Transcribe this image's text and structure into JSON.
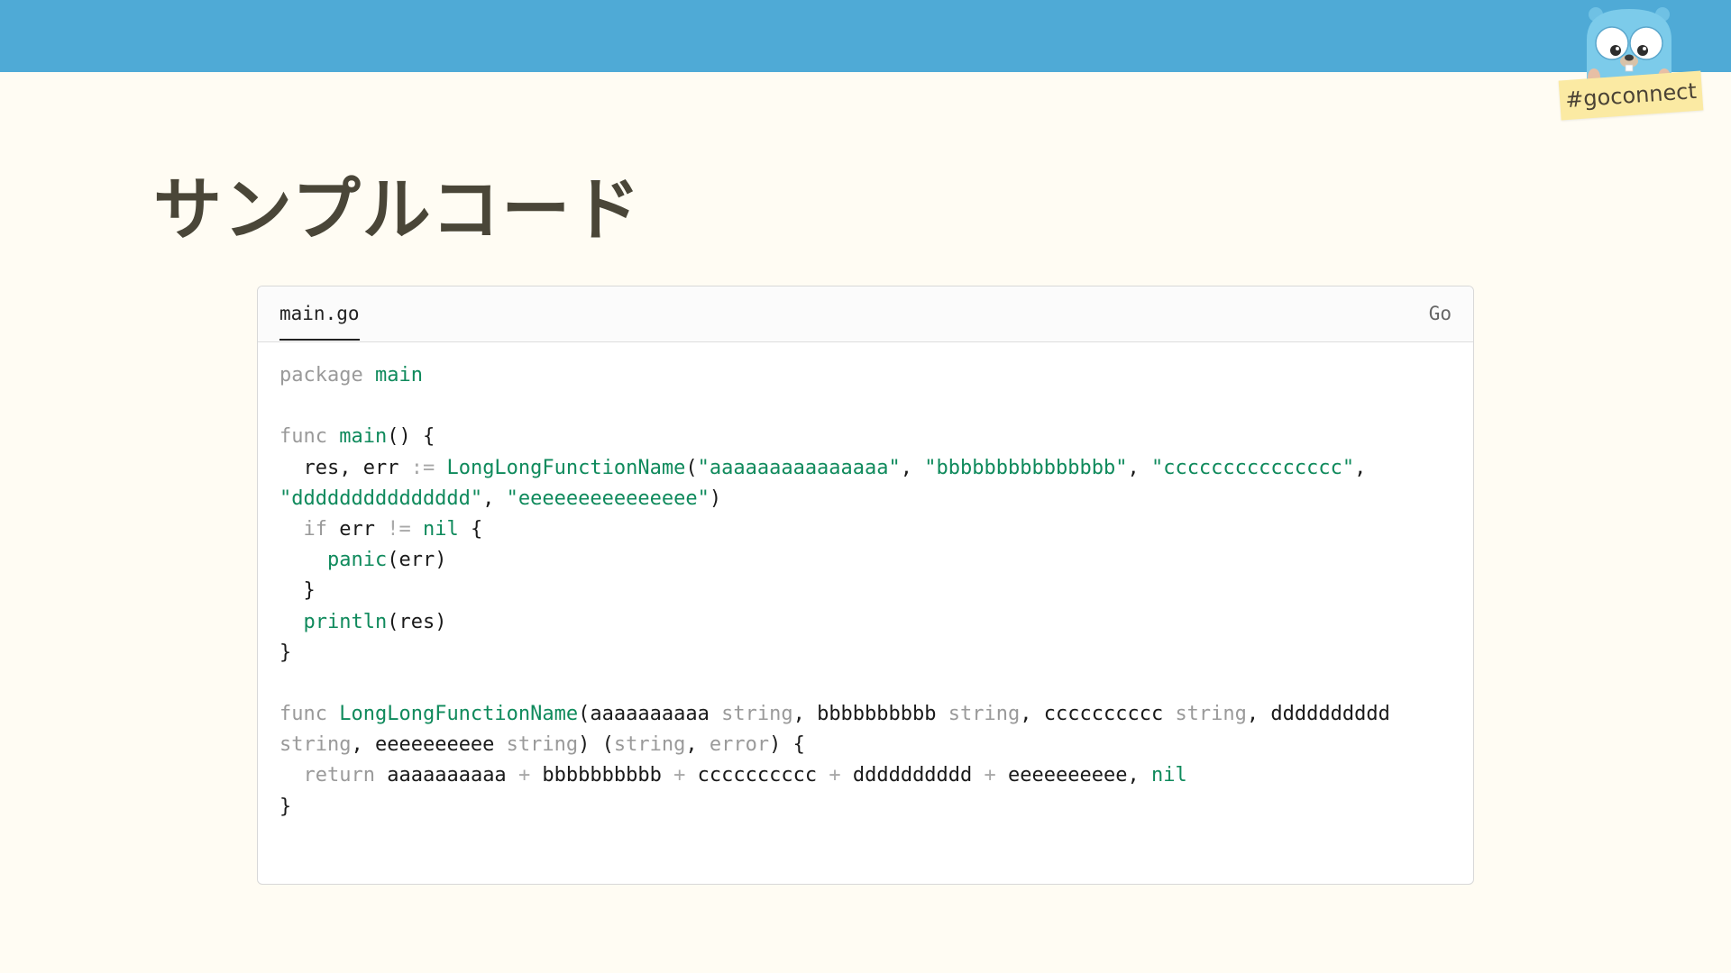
{
  "slide": {
    "title": "サンプルコード",
    "tag": "#goconnect"
  },
  "colors": {
    "header_bar": "#4faad6",
    "background": "#fffcf3",
    "title": "#4a4638",
    "token_keyword": "#9a9a9a",
    "token_identifier": "#0f8a5c",
    "token_plain": "#1a1a1a"
  },
  "icons": {
    "mascot": "gopher-mascot-icon"
  },
  "code_block": {
    "filename": "main.go",
    "language": "Go",
    "lines": [
      [
        {
          "t": "package ",
          "c": "kw"
        },
        {
          "t": "main",
          "c": "fn"
        }
      ],
      [],
      [
        {
          "t": "func ",
          "c": "kw"
        },
        {
          "t": "main",
          "c": "fn"
        },
        {
          "t": "() {",
          "c": "plain"
        }
      ],
      [
        {
          "t": "  res, err ",
          "c": "plain"
        },
        {
          "t": ":=",
          "c": "op"
        },
        {
          "t": " ",
          "c": "plain"
        },
        {
          "t": "LongLongFunctionName",
          "c": "fn"
        },
        {
          "t": "(",
          "c": "plain"
        },
        {
          "t": "\"aaaaaaaaaaaaaaa\"",
          "c": "str"
        },
        {
          "t": ", ",
          "c": "plain"
        },
        {
          "t": "\"bbbbbbbbbbbbbbb\"",
          "c": "str"
        },
        {
          "t": ", ",
          "c": "plain"
        },
        {
          "t": "\"ccccccccccccccc\"",
          "c": "str"
        },
        {
          "t": ",",
          "c": "plain"
        }
      ],
      [
        {
          "t": "\"ddddddddddddddd\"",
          "c": "str"
        },
        {
          "t": ", ",
          "c": "plain"
        },
        {
          "t": "\"eeeeeeeeeeeeeee\"",
          "c": "str"
        },
        {
          "t": ")",
          "c": "plain"
        }
      ],
      [
        {
          "t": "  ",
          "c": "plain"
        },
        {
          "t": "if",
          "c": "kw"
        },
        {
          "t": " err ",
          "c": "plain"
        },
        {
          "t": "!=",
          "c": "op"
        },
        {
          "t": " ",
          "c": "plain"
        },
        {
          "t": "nil",
          "c": "fn"
        },
        {
          "t": " {",
          "c": "plain"
        }
      ],
      [
        {
          "t": "    ",
          "c": "plain"
        },
        {
          "t": "panic",
          "c": "fn"
        },
        {
          "t": "(err)",
          "c": "plain"
        }
      ],
      [
        {
          "t": "  }",
          "c": "plain"
        }
      ],
      [
        {
          "t": "  ",
          "c": "plain"
        },
        {
          "t": "println",
          "c": "fn"
        },
        {
          "t": "(res)",
          "c": "plain"
        }
      ],
      [
        {
          "t": "}",
          "c": "plain"
        }
      ],
      [],
      [
        {
          "t": "func ",
          "c": "kw"
        },
        {
          "t": "LongLongFunctionName",
          "c": "fn"
        },
        {
          "t": "(aaaaaaaaaa ",
          "c": "plain"
        },
        {
          "t": "string",
          "c": "kw"
        },
        {
          "t": ", bbbbbbbbbb ",
          "c": "plain"
        },
        {
          "t": "string",
          "c": "kw"
        },
        {
          "t": ", cccccccccc ",
          "c": "plain"
        },
        {
          "t": "string",
          "c": "kw"
        },
        {
          "t": ", dddddddddd",
          "c": "plain"
        }
      ],
      [
        {
          "t": "string",
          "c": "kw"
        },
        {
          "t": ", eeeeeeeeee ",
          "c": "plain"
        },
        {
          "t": "string",
          "c": "kw"
        },
        {
          "t": ") (",
          "c": "plain"
        },
        {
          "t": "string",
          "c": "kw"
        },
        {
          "t": ", ",
          "c": "plain"
        },
        {
          "t": "error",
          "c": "kw"
        },
        {
          "t": ") {",
          "c": "plain"
        }
      ],
      [
        {
          "t": "  ",
          "c": "plain"
        },
        {
          "t": "return",
          "c": "kw"
        },
        {
          "t": " aaaaaaaaaa ",
          "c": "plain"
        },
        {
          "t": "+",
          "c": "op"
        },
        {
          "t": " bbbbbbbbbb ",
          "c": "plain"
        },
        {
          "t": "+",
          "c": "op"
        },
        {
          "t": " cccccccccc ",
          "c": "plain"
        },
        {
          "t": "+",
          "c": "op"
        },
        {
          "t": " dddddddddd ",
          "c": "plain"
        },
        {
          "t": "+",
          "c": "op"
        },
        {
          "t": " eeeeeeeeee, ",
          "c": "plain"
        },
        {
          "t": "nil",
          "c": "fn"
        }
      ],
      [
        {
          "t": "}",
          "c": "plain"
        }
      ]
    ]
  }
}
